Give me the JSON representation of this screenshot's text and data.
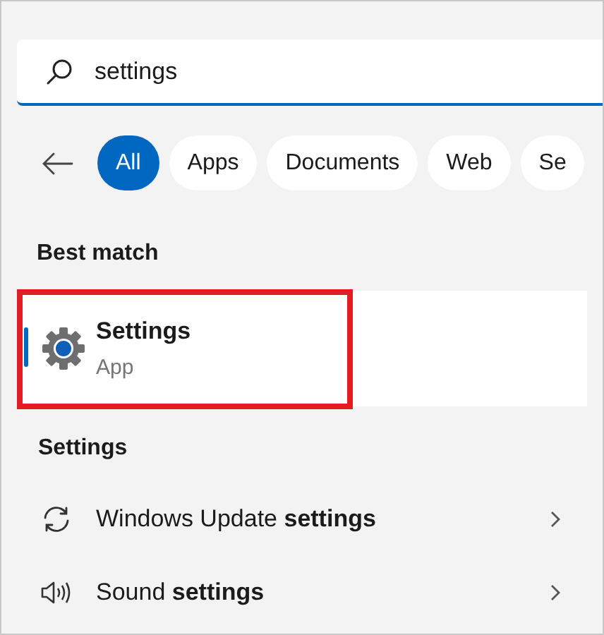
{
  "search": {
    "value": "settings"
  },
  "filters": [
    {
      "label": "All",
      "selected": true
    },
    {
      "label": "Apps",
      "selected": false
    },
    {
      "label": "Documents",
      "selected": false
    },
    {
      "label": "Web",
      "selected": false
    },
    {
      "label": "Se",
      "selected": false
    }
  ],
  "best_match": {
    "heading": "Best match",
    "title": "Settings",
    "subtitle": "App",
    "selected": true,
    "annotated": true
  },
  "section": {
    "heading": "Settings",
    "items": [
      {
        "kind": "update",
        "label": "Windows Update **settings**"
      },
      {
        "kind": "sound",
        "label": "Sound **settings**"
      }
    ]
  }
}
